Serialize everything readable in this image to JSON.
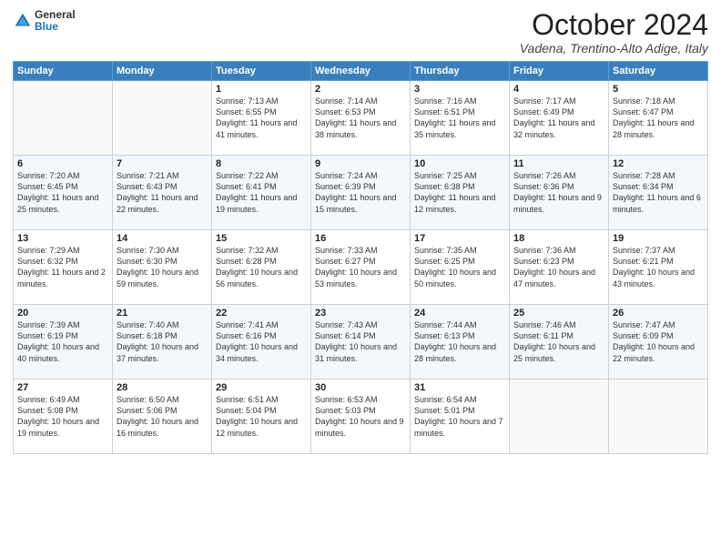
{
  "logo": {
    "general": "General",
    "blue": "Blue"
  },
  "header": {
    "title": "October 2024",
    "location": "Vadena, Trentino-Alto Adige, Italy"
  },
  "columns": [
    "Sunday",
    "Monday",
    "Tuesday",
    "Wednesday",
    "Thursday",
    "Friday",
    "Saturday"
  ],
  "weeks": [
    [
      {
        "day": "",
        "sunrise": "",
        "sunset": "",
        "daylight": ""
      },
      {
        "day": "",
        "sunrise": "",
        "sunset": "",
        "daylight": ""
      },
      {
        "day": "1",
        "sunrise": "Sunrise: 7:13 AM",
        "sunset": "Sunset: 6:55 PM",
        "daylight": "Daylight: 11 hours and 41 minutes."
      },
      {
        "day": "2",
        "sunrise": "Sunrise: 7:14 AM",
        "sunset": "Sunset: 6:53 PM",
        "daylight": "Daylight: 11 hours and 38 minutes."
      },
      {
        "day": "3",
        "sunrise": "Sunrise: 7:16 AM",
        "sunset": "Sunset: 6:51 PM",
        "daylight": "Daylight: 11 hours and 35 minutes."
      },
      {
        "day": "4",
        "sunrise": "Sunrise: 7:17 AM",
        "sunset": "Sunset: 6:49 PM",
        "daylight": "Daylight: 11 hours and 32 minutes."
      },
      {
        "day": "5",
        "sunrise": "Sunrise: 7:18 AM",
        "sunset": "Sunset: 6:47 PM",
        "daylight": "Daylight: 11 hours and 28 minutes."
      }
    ],
    [
      {
        "day": "6",
        "sunrise": "Sunrise: 7:20 AM",
        "sunset": "Sunset: 6:45 PM",
        "daylight": "Daylight: 11 hours and 25 minutes."
      },
      {
        "day": "7",
        "sunrise": "Sunrise: 7:21 AM",
        "sunset": "Sunset: 6:43 PM",
        "daylight": "Daylight: 11 hours and 22 minutes."
      },
      {
        "day": "8",
        "sunrise": "Sunrise: 7:22 AM",
        "sunset": "Sunset: 6:41 PM",
        "daylight": "Daylight: 11 hours and 19 minutes."
      },
      {
        "day": "9",
        "sunrise": "Sunrise: 7:24 AM",
        "sunset": "Sunset: 6:39 PM",
        "daylight": "Daylight: 11 hours and 15 minutes."
      },
      {
        "day": "10",
        "sunrise": "Sunrise: 7:25 AM",
        "sunset": "Sunset: 6:38 PM",
        "daylight": "Daylight: 11 hours and 12 minutes."
      },
      {
        "day": "11",
        "sunrise": "Sunrise: 7:26 AM",
        "sunset": "Sunset: 6:36 PM",
        "daylight": "Daylight: 11 hours and 9 minutes."
      },
      {
        "day": "12",
        "sunrise": "Sunrise: 7:28 AM",
        "sunset": "Sunset: 6:34 PM",
        "daylight": "Daylight: 11 hours and 6 minutes."
      }
    ],
    [
      {
        "day": "13",
        "sunrise": "Sunrise: 7:29 AM",
        "sunset": "Sunset: 6:32 PM",
        "daylight": "Daylight: 11 hours and 2 minutes."
      },
      {
        "day": "14",
        "sunrise": "Sunrise: 7:30 AM",
        "sunset": "Sunset: 6:30 PM",
        "daylight": "Daylight: 10 hours and 59 minutes."
      },
      {
        "day": "15",
        "sunrise": "Sunrise: 7:32 AM",
        "sunset": "Sunset: 6:28 PM",
        "daylight": "Daylight: 10 hours and 56 minutes."
      },
      {
        "day": "16",
        "sunrise": "Sunrise: 7:33 AM",
        "sunset": "Sunset: 6:27 PM",
        "daylight": "Daylight: 10 hours and 53 minutes."
      },
      {
        "day": "17",
        "sunrise": "Sunrise: 7:35 AM",
        "sunset": "Sunset: 6:25 PM",
        "daylight": "Daylight: 10 hours and 50 minutes."
      },
      {
        "day": "18",
        "sunrise": "Sunrise: 7:36 AM",
        "sunset": "Sunset: 6:23 PM",
        "daylight": "Daylight: 10 hours and 47 minutes."
      },
      {
        "day": "19",
        "sunrise": "Sunrise: 7:37 AM",
        "sunset": "Sunset: 6:21 PM",
        "daylight": "Daylight: 10 hours and 43 minutes."
      }
    ],
    [
      {
        "day": "20",
        "sunrise": "Sunrise: 7:39 AM",
        "sunset": "Sunset: 6:19 PM",
        "daylight": "Daylight: 10 hours and 40 minutes."
      },
      {
        "day": "21",
        "sunrise": "Sunrise: 7:40 AM",
        "sunset": "Sunset: 6:18 PM",
        "daylight": "Daylight: 10 hours and 37 minutes."
      },
      {
        "day": "22",
        "sunrise": "Sunrise: 7:41 AM",
        "sunset": "Sunset: 6:16 PM",
        "daylight": "Daylight: 10 hours and 34 minutes."
      },
      {
        "day": "23",
        "sunrise": "Sunrise: 7:43 AM",
        "sunset": "Sunset: 6:14 PM",
        "daylight": "Daylight: 10 hours and 31 minutes."
      },
      {
        "day": "24",
        "sunrise": "Sunrise: 7:44 AM",
        "sunset": "Sunset: 6:13 PM",
        "daylight": "Daylight: 10 hours and 28 minutes."
      },
      {
        "day": "25",
        "sunrise": "Sunrise: 7:46 AM",
        "sunset": "Sunset: 6:11 PM",
        "daylight": "Daylight: 10 hours and 25 minutes."
      },
      {
        "day": "26",
        "sunrise": "Sunrise: 7:47 AM",
        "sunset": "Sunset: 6:09 PM",
        "daylight": "Daylight: 10 hours and 22 minutes."
      }
    ],
    [
      {
        "day": "27",
        "sunrise": "Sunrise: 6:49 AM",
        "sunset": "Sunset: 5:08 PM",
        "daylight": "Daylight: 10 hours and 19 minutes."
      },
      {
        "day": "28",
        "sunrise": "Sunrise: 6:50 AM",
        "sunset": "Sunset: 5:06 PM",
        "daylight": "Daylight: 10 hours and 16 minutes."
      },
      {
        "day": "29",
        "sunrise": "Sunrise: 6:51 AM",
        "sunset": "Sunset: 5:04 PM",
        "daylight": "Daylight: 10 hours and 12 minutes."
      },
      {
        "day": "30",
        "sunrise": "Sunrise: 6:53 AM",
        "sunset": "Sunset: 5:03 PM",
        "daylight": "Daylight: 10 hours and 9 minutes."
      },
      {
        "day": "31",
        "sunrise": "Sunrise: 6:54 AM",
        "sunset": "Sunset: 5:01 PM",
        "daylight": "Daylight: 10 hours and 7 minutes."
      },
      {
        "day": "",
        "sunrise": "",
        "sunset": "",
        "daylight": ""
      },
      {
        "day": "",
        "sunrise": "",
        "sunset": "",
        "daylight": ""
      }
    ]
  ]
}
